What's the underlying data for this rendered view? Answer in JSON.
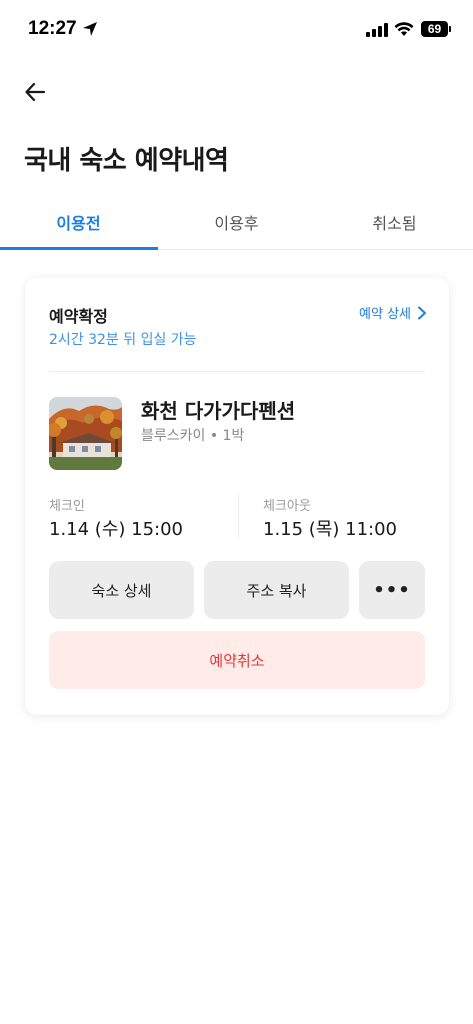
{
  "status_bar": {
    "time": "12:27",
    "battery": "69"
  },
  "header": {
    "title": "국내 숙소 예약내역"
  },
  "tabs": [
    {
      "label": "이용전",
      "active": true
    },
    {
      "label": "이용후",
      "active": false
    },
    {
      "label": "취소됨",
      "active": false
    }
  ],
  "reservation": {
    "status_title": "예약확정",
    "status_sub": "2시간 32분 뒤 입실 가능",
    "detail_link": "예약 상세",
    "hotel_name": "화천 다가가다펜션",
    "room_info": "블루스카이 • 1박",
    "checkin_label": "체크인",
    "checkin_value": "1.14 (수) 15:00",
    "checkout_label": "체크아웃",
    "checkout_value": "1.15 (목) 11:00",
    "buttons": {
      "detail": "숙소 상세",
      "copy_address": "주소 복사",
      "more": "•••",
      "cancel": "예약취소"
    }
  },
  "colors": {
    "accent": "#1e7de0",
    "cancel_text": "#e03a3a",
    "cancel_bg": "#ffebe8"
  }
}
